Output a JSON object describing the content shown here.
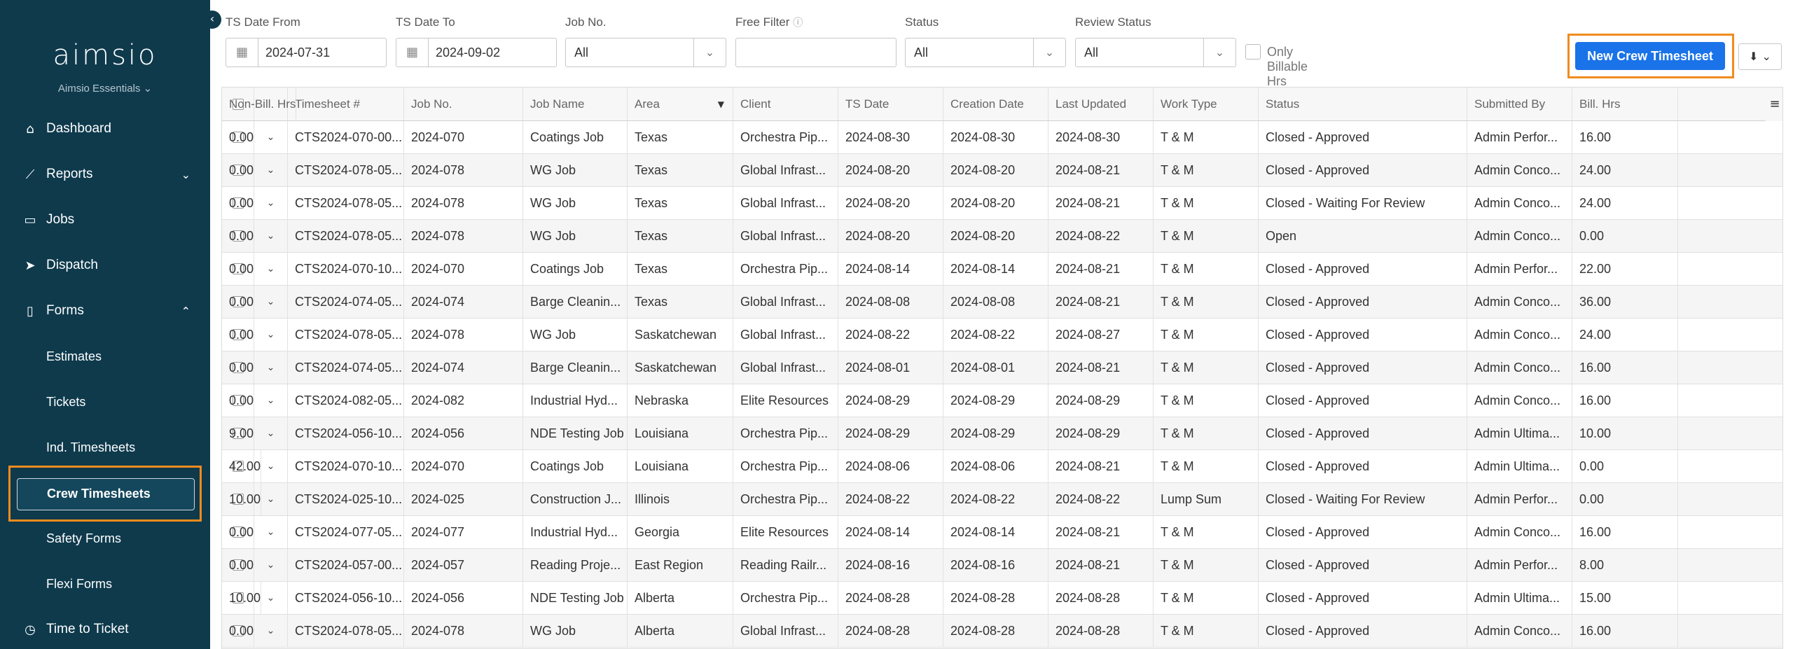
{
  "sidebar": {
    "logo": "aimsio",
    "tenant": "Aimsio Essentials ⌄",
    "items": [
      {
        "label": "Dashboard",
        "icon": "⌂"
      },
      {
        "label": "Reports",
        "icon": "⟋",
        "chevron": "⌄"
      },
      {
        "label": "Jobs",
        "icon": "▭"
      },
      {
        "label": "Dispatch",
        "icon": "➤"
      },
      {
        "label": "Forms",
        "icon": "▯",
        "chevron": "⌃"
      },
      {
        "label": "Time to Ticket",
        "icon": "◷"
      }
    ],
    "sub_items": [
      "Estimates",
      "Tickets",
      "Ind. Timesheets",
      "Crew Timesheets",
      "Safety Forms",
      "Flexi Forms"
    ],
    "active": "Crew Timesheets"
  },
  "filters": {
    "ts_date_from": {
      "label": "TS Date From",
      "value": "2024-07-31"
    },
    "ts_date_to": {
      "label": "TS Date To",
      "value": "2024-09-02"
    },
    "job_no": {
      "label": "Job No.",
      "value": "All"
    },
    "free_filter": {
      "label": "Free Filter",
      "info": "ⓘ",
      "value": ""
    },
    "status": {
      "label": "Status",
      "value": "All"
    },
    "review_status": {
      "label": "Review Status",
      "value": "All"
    },
    "only_billable": {
      "label": "Only Billable Hrs",
      "checked": false
    }
  },
  "toolbar": {
    "new_label": "New Crew Timesheet",
    "export_icon": "⬇ ⌄"
  },
  "table": {
    "headers": [
      "Timesheet #",
      "Job No.",
      "Job Name",
      "Area",
      "Client",
      "TS Date",
      "Creation Date",
      "Last Updated",
      "Work Type",
      "Status",
      "Submitted By",
      "Bill. Hrs",
      "Non-Bill. Hrs"
    ],
    "sorted_column": "Area",
    "sorted_direction": "descending",
    "rows": [
      [
        "CTS2024-070-00...",
        "2024-070",
        "Coatings Job",
        "Texas",
        "Orchestra Pip...",
        "2024-08-30",
        "2024-08-30",
        "2024-08-30",
        "T & M",
        "Closed - Approved",
        "Admin Perfor...",
        "16.00",
        "0.00"
      ],
      [
        "CTS2024-078-05...",
        "2024-078",
        "WG Job",
        "Texas",
        "Global Infrast...",
        "2024-08-20",
        "2024-08-20",
        "2024-08-21",
        "T & M",
        "Closed - Approved",
        "Admin Conco...",
        "24.00",
        "0.00"
      ],
      [
        "CTS2024-078-05...",
        "2024-078",
        "WG Job",
        "Texas",
        "Global Infrast...",
        "2024-08-20",
        "2024-08-20",
        "2024-08-21",
        "T & M",
        "Closed - Waiting For Review",
        "Admin Conco...",
        "24.00",
        "0.00"
      ],
      [
        "CTS2024-078-05...",
        "2024-078",
        "WG Job",
        "Texas",
        "Global Infrast...",
        "2024-08-20",
        "2024-08-20",
        "2024-08-22",
        "T & M",
        "Open",
        "Admin Conco...",
        "0.00",
        "0.00"
      ],
      [
        "CTS2024-070-10...",
        "2024-070",
        "Coatings Job",
        "Texas",
        "Orchestra Pip...",
        "2024-08-14",
        "2024-08-14",
        "2024-08-21",
        "T & M",
        "Closed - Approved",
        "Admin Perfor...",
        "22.00",
        "0.00"
      ],
      [
        "CTS2024-074-05...",
        "2024-074",
        "Barge Cleanin...",
        "Texas",
        "Global Infrast...",
        "2024-08-08",
        "2024-08-08",
        "2024-08-21",
        "T & M",
        "Closed - Approved",
        "Admin Conco...",
        "36.00",
        "0.00"
      ],
      [
        "CTS2024-078-05...",
        "2024-078",
        "WG Job",
        "Saskatchewan",
        "Global Infrast...",
        "2024-08-22",
        "2024-08-22",
        "2024-08-27",
        "T & M",
        "Closed - Approved",
        "Admin Conco...",
        "24.00",
        "0.00"
      ],
      [
        "CTS2024-074-05...",
        "2024-074",
        "Barge Cleanin...",
        "Saskatchewan",
        "Global Infrast...",
        "2024-08-01",
        "2024-08-01",
        "2024-08-21",
        "T & M",
        "Closed - Approved",
        "Admin Conco...",
        "16.00",
        "0.00"
      ],
      [
        "CTS2024-082-05...",
        "2024-082",
        "Industrial Hyd...",
        "Nebraska",
        "Elite Resources",
        "2024-08-29",
        "2024-08-29",
        "2024-08-29",
        "T & M",
        "Closed - Approved",
        "Admin Conco...",
        "16.00",
        "0.00"
      ],
      [
        "CTS2024-056-10...",
        "2024-056",
        "NDE Testing Job",
        "Louisiana",
        "Orchestra Pip...",
        "2024-08-29",
        "2024-08-29",
        "2024-08-29",
        "T & M",
        "Closed - Approved",
        "Admin Ultima...",
        "10.00",
        "9.00"
      ],
      [
        "CTS2024-070-10...",
        "2024-070",
        "Coatings Job",
        "Louisiana",
        "Orchestra Pip...",
        "2024-08-06",
        "2024-08-06",
        "2024-08-21",
        "T & M",
        "Closed - Approved",
        "Admin Ultima...",
        "0.00",
        "42.00"
      ],
      [
        "CTS2024-025-10...",
        "2024-025",
        "Construction J...",
        "Illinois",
        "Orchestra Pip...",
        "2024-08-22",
        "2024-08-22",
        "2024-08-22",
        "Lump Sum",
        "Closed - Waiting For Review",
        "Admin Perfor...",
        "0.00",
        "10.00"
      ],
      [
        "CTS2024-077-05...",
        "2024-077",
        "Industrial Hyd...",
        "Georgia",
        "Elite Resources",
        "2024-08-14",
        "2024-08-14",
        "2024-08-21",
        "T & M",
        "Closed - Approved",
        "Admin Conco...",
        "16.00",
        "0.00"
      ],
      [
        "CTS2024-057-00...",
        "2024-057",
        "Reading Proje...",
        "East Region",
        "Reading Railr...",
        "2024-08-16",
        "2024-08-16",
        "2024-08-21",
        "T & M",
        "Closed - Approved",
        "Admin Perfor...",
        "8.00",
        "0.00"
      ],
      [
        "CTS2024-056-10...",
        "2024-056",
        "NDE Testing Job",
        "Alberta",
        "Orchestra Pip...",
        "2024-08-28",
        "2024-08-28",
        "2024-08-28",
        "T & M",
        "Closed - Approved",
        "Admin Ultima...",
        "15.00",
        "10.00"
      ],
      [
        "CTS2024-078-05...",
        "2024-078",
        "WG Job",
        "Alberta",
        "Global Infrast...",
        "2024-08-28",
        "2024-08-28",
        "2024-08-28",
        "T & M",
        "Closed - Approved",
        "Admin Conco...",
        "16.00",
        "0.00"
      ]
    ]
  },
  "colors": {
    "sidebar_bg": "#0e3a4c",
    "accent": "#1a73e8",
    "highlight_outline": "#f08c1e"
  }
}
